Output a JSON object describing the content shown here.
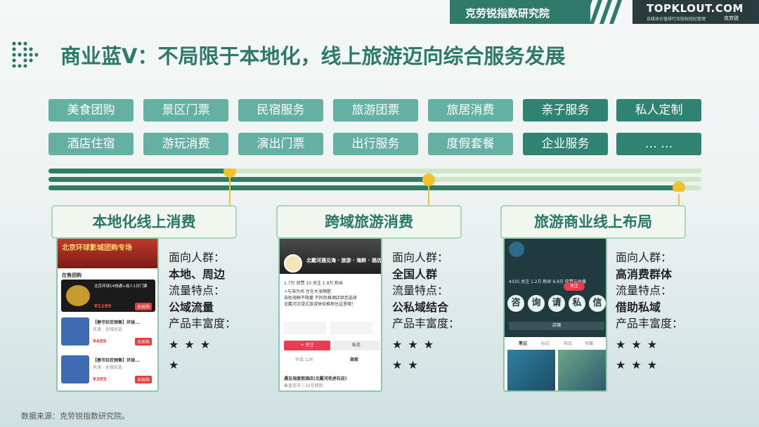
{
  "header": {
    "org_name": "克劳锐指数研究院",
    "logo_main": "TOPKLOUT.COM",
    "logo_sub": "自媒体价值排行及版权经纪管理",
    "logo_cn": "克劳锐"
  },
  "title": "商业蓝V：不局限于本地化，线上旅游迈向综合服务发展",
  "tags_row1": [
    "美食团购",
    "景区门票",
    "民宿服务",
    "旅游团票",
    "旅居消费",
    "亲子服务",
    "私人定制"
  ],
  "tags_row2": [
    "酒店住宿",
    "游玩消费",
    "演出门票",
    "出行服务",
    "度假套餐",
    "企业服务",
    "… …"
  ],
  "stages": [
    {
      "title": "本地化线上消费",
      "audience_label": "面向人群：",
      "audience": "本地、周边",
      "traffic_label": "流量特点：",
      "traffic": "公域流量",
      "richness_label": "产品丰富度：",
      "stars_line1": "★★★",
      "stars_line2": "★"
    },
    {
      "title": "跨域旅游消费",
      "audience_label": "面向人群：",
      "audience": "全国人群",
      "traffic_label": "流量特点：",
      "traffic": "公私域结合",
      "richness_label": "产品丰富度：",
      "stars_line1": "★★★",
      "stars_line2": "★★"
    },
    {
      "title": "旅游商业线上布局",
      "audience_label": "面向人群：",
      "audience": "高消费群体",
      "traffic_label": "流量特点：",
      "traffic": "借助私域",
      "richness_label": "产品丰富度：",
      "stars_line1": "★★★",
      "stars_line2": "★★★"
    }
  ],
  "phone1": {
    "banner": "北京环球影城团购专场",
    "section": "在售团购",
    "item1": "北京环球14线通+成人1日门票",
    "item1_price": "¥1199",
    "item2": "【春节狂欢预售】环球...",
    "item2_loc": "天津 · 全城优选",
    "item2_price": "¥489",
    "item3": "【春节狂欢预售】环球...",
    "item3_loc": "天津 · 全城优选",
    "item3_price": "¥389",
    "buy": "去抢购"
  },
  "phone2": {
    "name": "北戴河遇见海 · 旅游 · 海鲜 · 酒店",
    "stats": "1.7万 获赞  10 关注  1.9万 粉丝",
    "desc1": "↗与海为邻 住在大海隔壁",
    "desc2": "自助海鲜不限量 不同风格酒店供您选择",
    "desc3": "北戴河沉浸式旅游体验推荐住这里哦！",
    "btn_follow": "+ 关注",
    "btn_msg": "私信",
    "tab1": "作品 126",
    "tab2": "商家",
    "store": "遇见海度假酒店(北戴河老虎石店)",
    "store_addr": "秦皇岛市 | 32号西街"
  },
  "phone3": {
    "stats": "4335 关注   1.2万 粉丝   6.9万 获赞与收藏",
    "follow": "关注",
    "chars": [
      "咨",
      "询",
      "请",
      "私",
      "信"
    ],
    "store_btn": "店铺",
    "tabs": [
      "笔记",
      "标记",
      "商品",
      "收藏"
    ]
  },
  "source": "数据来源：克劳锐指数研究院。",
  "colors": {
    "brand_green": "#2c7a68",
    "tag_light": "#64b1a3",
    "tag_dark": "#2e8372",
    "timeline_dark": "#2f7d63",
    "timeline_light": "#cfe6c9",
    "marker": "#f2c12e"
  }
}
